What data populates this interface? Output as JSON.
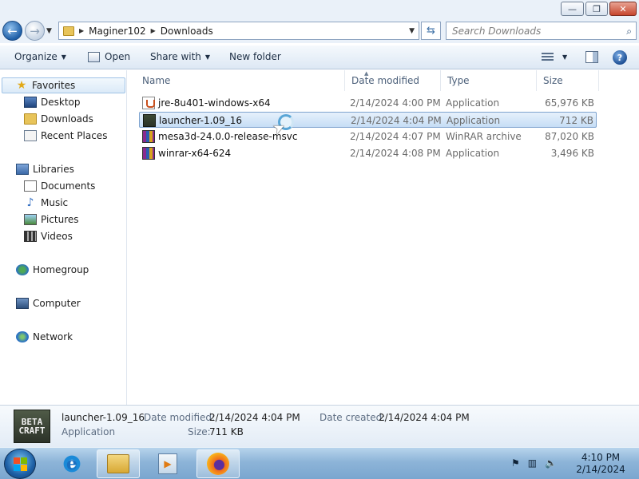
{
  "window_controls": {
    "minimize": "—",
    "maximize": "❐",
    "close": "✕"
  },
  "nav": {
    "back": "←",
    "forward": "→",
    "breadcrumb": [
      "Maginer102",
      "Downloads"
    ],
    "search_placeholder": "Search Downloads"
  },
  "toolbar": {
    "organize": "Organize",
    "open": "Open",
    "share_with": "Share with",
    "new_folder": "New folder",
    "help": "?"
  },
  "sidebar": {
    "favorites": "Favorites",
    "favorites_items": [
      "Desktop",
      "Downloads",
      "Recent Places"
    ],
    "libraries": "Libraries",
    "libraries_items": [
      "Documents",
      "Music",
      "Pictures",
      "Videos"
    ],
    "homegroup": "Homegroup",
    "computer": "Computer",
    "network": "Network"
  },
  "columns": {
    "name": "Name",
    "date": "Date modified",
    "type": "Type",
    "size": "Size"
  },
  "files": [
    {
      "name": "jre-8u401-windows-x64",
      "date": "2/14/2024 4:00 PM",
      "type": "Application",
      "size": "65,976 KB",
      "icon": "java-installer-icon",
      "selected": false
    },
    {
      "name": "launcher-1.09_16",
      "date": "2/14/2024 4:04 PM",
      "type": "Application",
      "size": "712 KB",
      "icon": "betacraft-icon",
      "selected": true
    },
    {
      "name": "mesa3d-24.0.0-release-msvc",
      "date": "2/14/2024 4:07 PM",
      "type": "WinRAR archive",
      "size": "87,020 KB",
      "icon": "winrar-icon",
      "selected": false
    },
    {
      "name": "winrar-x64-624",
      "date": "2/14/2024 4:08 PM",
      "type": "Application",
      "size": "3,496 KB",
      "icon": "winrar-icon",
      "selected": false
    }
  ],
  "details": {
    "logo_line1": "BETA",
    "logo_line2": "CRAFT",
    "name": "launcher-1.09_16",
    "type": "Application",
    "date_modified_label": "Date modified:",
    "date_modified": "2/14/2024 4:04 PM",
    "date_created_label": "Date created:",
    "date_created": "2/14/2024 4:04 PM",
    "size_label": "Size:",
    "size": "711 KB"
  },
  "taskbar": {
    "clock_time": "4:10 PM",
    "clock_date": "2/14/2024"
  },
  "colors": {
    "selection": "#c6ddf5",
    "taskbar": "#8db4d8",
    "accent": "#1f5fa7"
  }
}
